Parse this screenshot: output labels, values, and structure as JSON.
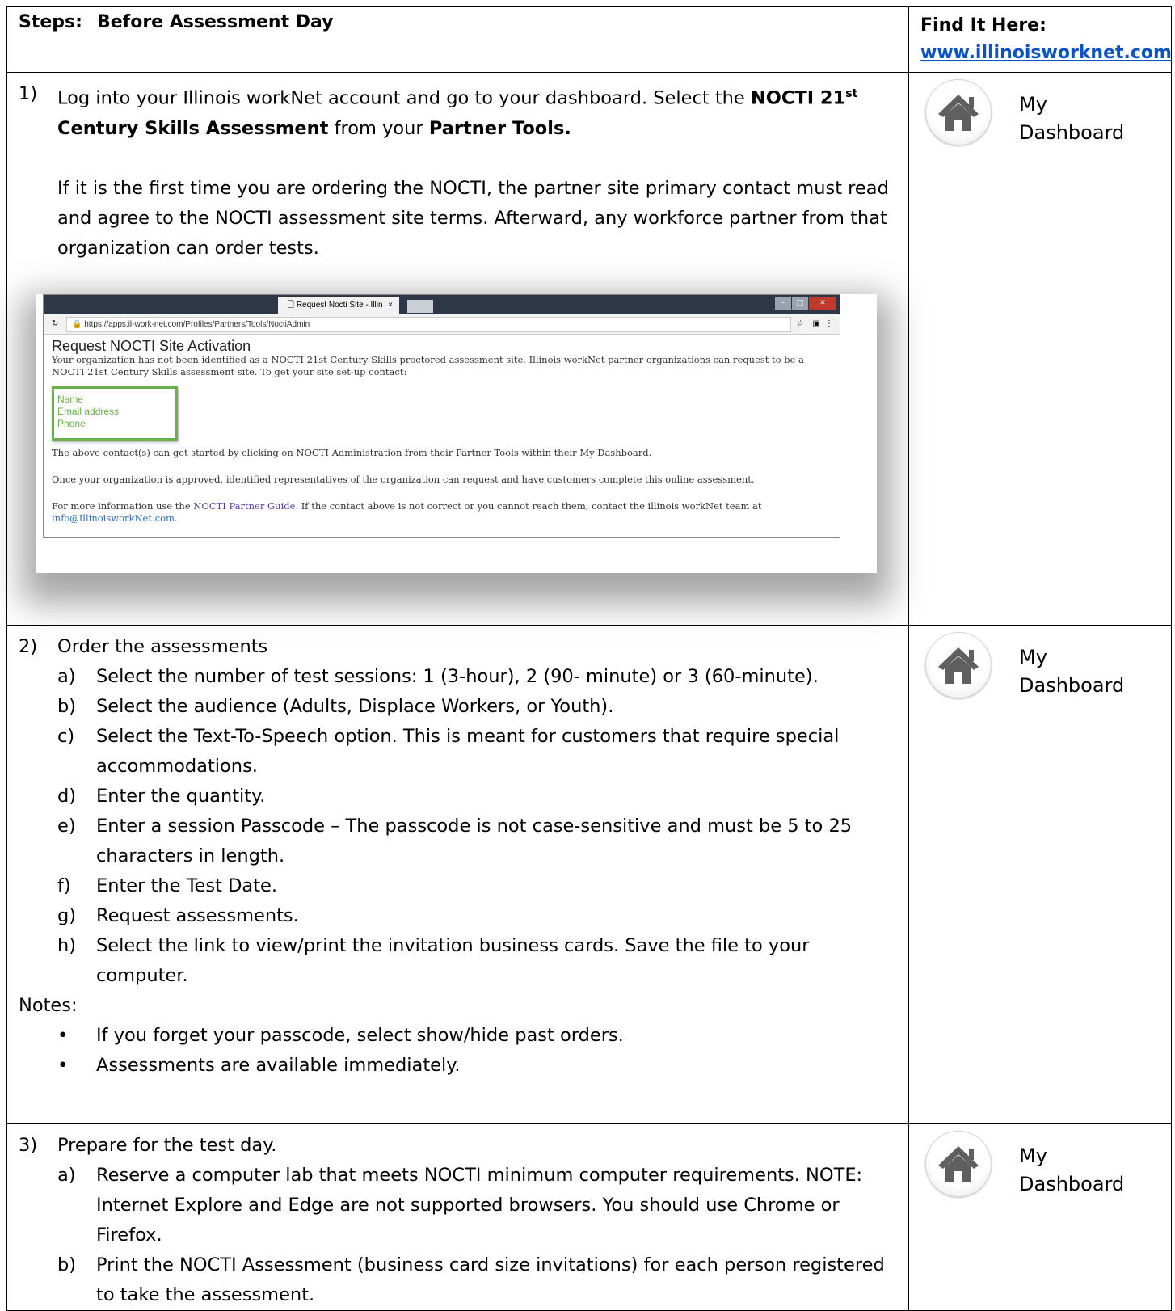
{
  "header": {
    "steps_label": "Steps:",
    "steps_title": "Before Assessment Day",
    "find_label": "Find It Here:",
    "find_link": "www.illinoisworknet.com"
  },
  "dashboard_label_line1": "My",
  "dashboard_label_line2": "Dashboard",
  "step1": {
    "num": "1)",
    "text_a": "Log into your Illinois workNet account and go to your dashboard. Select the ",
    "bold_a": "NOCTI 21",
    "sup": "st",
    "bold_b": " Century Skills Assessment",
    "text_b": " from your ",
    "bold_c": "Partner Tools.",
    "para2": "If it is the first time you are ordering the NOCTI, the partner site primary contact must read and agree to the NOCTI assessment site terms. Afterward, any workforce partner from that organization can order tests.",
    "screenshot": {
      "tab_title": "Request Nocti Site - Illin",
      "tab_close": "×",
      "url": "https://apps.il-work-net.com/Profiles/Partners/Tools/NoctiAdmin",
      "heading": "Request NOCTI Site Activation",
      "intro": "Your organization has not been identified as a NOCTI 21st Century Skills proctored assessment site. Illinois workNet partner organizations can request to be a NOCTI 21st Century Skills assessment site. To get your site set-up contact:",
      "contact_name": "Name",
      "contact_email": "Email address",
      "contact_phone": "Phone",
      "p1": "The above contact(s) can get started by clicking on NOCTI Administration from their Partner Tools within their My Dashboard.",
      "p2": "Once your organization is approved, identified representatives of the organization can request and have customers complete this online assessment.",
      "p3_a": "For more information use the ",
      "p3_link": "NOCTI Partner Guide",
      "p3_b": ". If the contact above is not correct or you cannot reach them, contact the illinois workNet team at",
      "p3_mail": "info@IllinoisworkNet.com",
      "p3_end": "."
    }
  },
  "step2": {
    "num": "2)",
    "title": "Order the assessments",
    "items": [
      {
        "letter": "a)",
        "text": "Select the number of test sessions: 1 (3-hour), 2 (90- minute) or 3 (60-minute)."
      },
      {
        "letter": "b)",
        "text": "Select the audience (Adults, Displace Workers, or Youth)."
      },
      {
        "letter": "c)",
        "text": "Select the Text-To-Speech option. This is meant for customers that require special accommodations."
      },
      {
        "letter": "d)",
        "text": "Enter the quantity."
      },
      {
        "letter": "e)",
        "text": "Enter a session Passcode – The passcode is not case-sensitive and must be 5 to 25 characters in length."
      },
      {
        "letter": "f)",
        "text": "Enter the Test Date."
      },
      {
        "letter": "g)",
        "text": "Request assessments."
      },
      {
        "letter": "h)",
        "text": "Select the link to view/print the invitation business cards.  Save the file to your computer."
      }
    ],
    "notes_label": "Notes:",
    "notes": [
      "If you forget your passcode, select show/hide past orders.",
      "Assessments are available immediately."
    ]
  },
  "step3": {
    "num": "3)",
    "title": "Prepare for the test day.",
    "items": [
      {
        "letter": "a)",
        "text": "Reserve a computer lab that meets NOCTI minimum computer requirements. NOTE:  Internet Explore and Edge are not supported browsers.  You should use Chrome or Firefox."
      },
      {
        "letter": "b)",
        "text": "Print the NOCTI Assessment (business card size invitations) for each person registered to take the assessment."
      }
    ]
  },
  "colors": {
    "link": "#0a53c6",
    "contact_green": "#6ab04c",
    "icon_gray": "#5f5f5f"
  },
  "icons": [
    "home-icon"
  ]
}
